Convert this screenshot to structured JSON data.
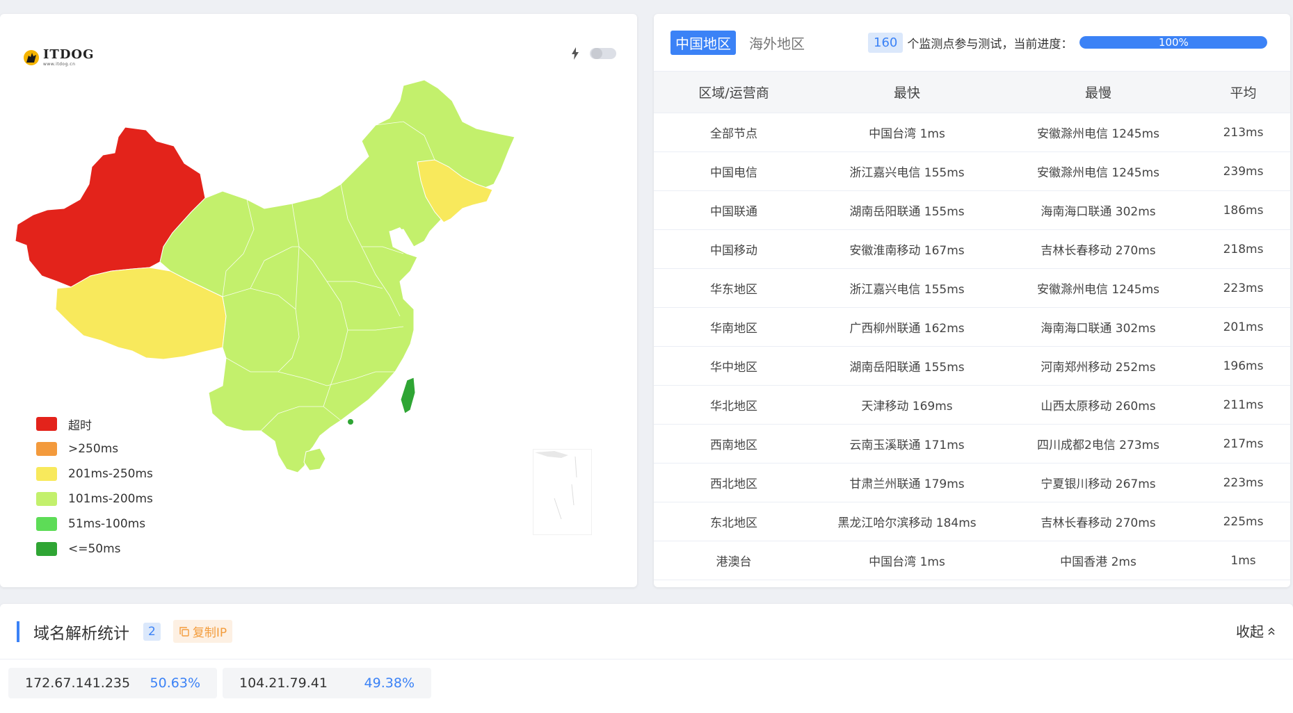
{
  "logo": {
    "name": "ITDOG",
    "url": "www.itdog.cn"
  },
  "colors": {
    "timeout": "#e3231b",
    "gt250": "#f39a3c",
    "r201_250": "#f8e95c",
    "r101_200": "#c3f06c",
    "r51_100": "#5ddc57",
    "le50": "#2fa534",
    "accent": "#3b82f6"
  },
  "legend": [
    {
      "label": "超时",
      "color": "#e3231b"
    },
    {
      "label": ">250ms",
      "color": "#f39a3c"
    },
    {
      "label": "201ms-250ms",
      "color": "#f8e95c"
    },
    {
      "label": "101ms-200ms",
      "color": "#c3f06c"
    },
    {
      "label": "51ms-100ms",
      "color": "#5ddc57"
    },
    {
      "label": "<=50ms",
      "color": "#2fa534"
    }
  ],
  "tabs": {
    "domestic": "中国地区",
    "overseas": "海外地区"
  },
  "monitor": {
    "count": "160",
    "text": "个监测点参与测试，当前进度：",
    "progress_label": "100%",
    "progress_fraction": 1.0
  },
  "table": {
    "headers": {
      "region": "区域/运营商",
      "fastest": "最快",
      "slowest": "最慢",
      "average": "平均"
    },
    "rows": [
      {
        "region": "全部节点",
        "fastest": "中国台湾 1ms",
        "slowest": "安徽滁州电信 1245ms",
        "average": "213ms"
      },
      {
        "region": "中国电信",
        "fastest": "浙江嘉兴电信 155ms",
        "slowest": "安徽滁州电信 1245ms",
        "average": "239ms"
      },
      {
        "region": "中国联通",
        "fastest": "湖南岳阳联通 155ms",
        "slowest": "海南海口联通 302ms",
        "average": "186ms"
      },
      {
        "region": "中国移动",
        "fastest": "安徽淮南移动 167ms",
        "slowest": "吉林长春移动 270ms",
        "average": "218ms"
      },
      {
        "region": "华东地区",
        "fastest": "浙江嘉兴电信 155ms",
        "slowest": "安徽滁州电信 1245ms",
        "average": "223ms"
      },
      {
        "region": "华南地区",
        "fastest": "广西柳州联通 162ms",
        "slowest": "海南海口联通 302ms",
        "average": "201ms"
      },
      {
        "region": "华中地区",
        "fastest": "湖南岳阳联通 155ms",
        "slowest": "河南郑州移动 252ms",
        "average": "196ms"
      },
      {
        "region": "华北地区",
        "fastest": "天津移动 169ms",
        "slowest": "山西太原移动 260ms",
        "average": "211ms"
      },
      {
        "region": "西南地区",
        "fastest": "云南玉溪联通 171ms",
        "slowest": "四川成都2电信 273ms",
        "average": "217ms"
      },
      {
        "region": "西北地区",
        "fastest": "甘肃兰州联通 179ms",
        "slowest": "宁夏银川移动 267ms",
        "average": "223ms"
      },
      {
        "region": "东北地区",
        "fastest": "黑龙江哈尔滨移动 184ms",
        "slowest": "吉林长春移动 270ms",
        "average": "225ms"
      },
      {
        "region": "港澳台",
        "fastest": "中国台湾 1ms",
        "slowest": "中国香港 2ms",
        "average": "1ms"
      }
    ]
  },
  "dns": {
    "title": "域名解析统计",
    "count": "2",
    "copy_label": "复制IP",
    "collapse_label": "收起",
    "ips": [
      {
        "ip": "172.67.141.235",
        "percent": "50.63%"
      },
      {
        "ip": "104.21.79.41",
        "percent": "49.38%"
      }
    ]
  }
}
